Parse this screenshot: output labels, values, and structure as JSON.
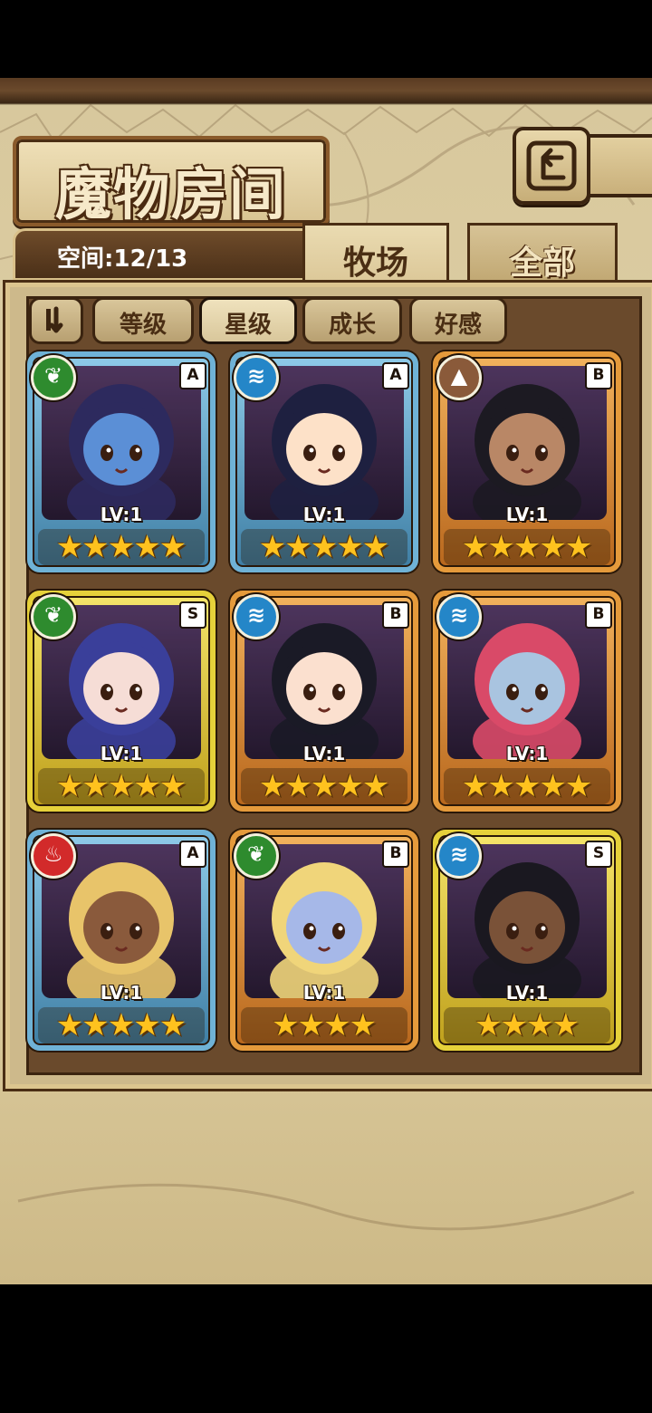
{
  "title": "魔物房间",
  "space": "空间:12/13",
  "tabs": [
    {
      "label": "牧场",
      "active": true
    },
    {
      "label": "全部",
      "active": false
    }
  ],
  "filters": [
    {
      "label": "等级",
      "active": false
    },
    {
      "label": "星级",
      "active": true
    },
    {
      "label": "成长",
      "active": false
    },
    {
      "label": "好感",
      "active": false
    }
  ],
  "elements": {
    "leaf": {
      "icon": "leaf-icon",
      "color": "#2e8b2e"
    },
    "water": {
      "icon": "water-icon",
      "color": "#2486c8"
    },
    "earth": {
      "icon": "mountain-icon",
      "color": "#8a5a3a"
    },
    "fire": {
      "icon": "flame-icon",
      "color": "#d22a2a"
    }
  },
  "cards": [
    {
      "element": "leaf",
      "rank": "A",
      "level": "LV:1",
      "stars": 5,
      "frame": "blue",
      "skin": "#5b8fd6",
      "hair": "#2d2a5e"
    },
    {
      "element": "water",
      "rank": "A",
      "level": "LV:1",
      "stars": 5,
      "frame": "blue",
      "skin": "#fde1c8",
      "hair": "#1e2040"
    },
    {
      "element": "earth",
      "rank": "B",
      "level": "LV:1",
      "stars": 5,
      "frame": "orange",
      "skin": "#b98766",
      "hair": "#1c1a22"
    },
    {
      "element": "leaf",
      "rank": "S",
      "level": "LV:1",
      "stars": 5,
      "frame": "gold",
      "skin": "#f6ddd6",
      "hair": "#3a3f9a"
    },
    {
      "element": "water",
      "rank": "B",
      "level": "LV:1",
      "stars": 5,
      "frame": "orange",
      "skin": "#fbe0cf",
      "hair": "#1a1a26"
    },
    {
      "element": "water",
      "rank": "B",
      "level": "LV:1",
      "stars": 5,
      "frame": "orange",
      "skin": "#a9c4e0",
      "hair": "#d94a68"
    },
    {
      "element": "fire",
      "rank": "A",
      "level": "LV:1",
      "stars": 5,
      "frame": "blue",
      "skin": "#8a5a3c",
      "hair": "#e8c46a"
    },
    {
      "element": "leaf",
      "rank": "B",
      "level": "LV:1",
      "stars": 4,
      "frame": "orange",
      "skin": "#a6b8e8",
      "hair": "#f0d57a"
    },
    {
      "element": "water",
      "rank": "S",
      "level": "LV:1",
      "stars": 4,
      "frame": "gold",
      "skin": "#7a5238",
      "hair": "#1a1820"
    }
  ]
}
